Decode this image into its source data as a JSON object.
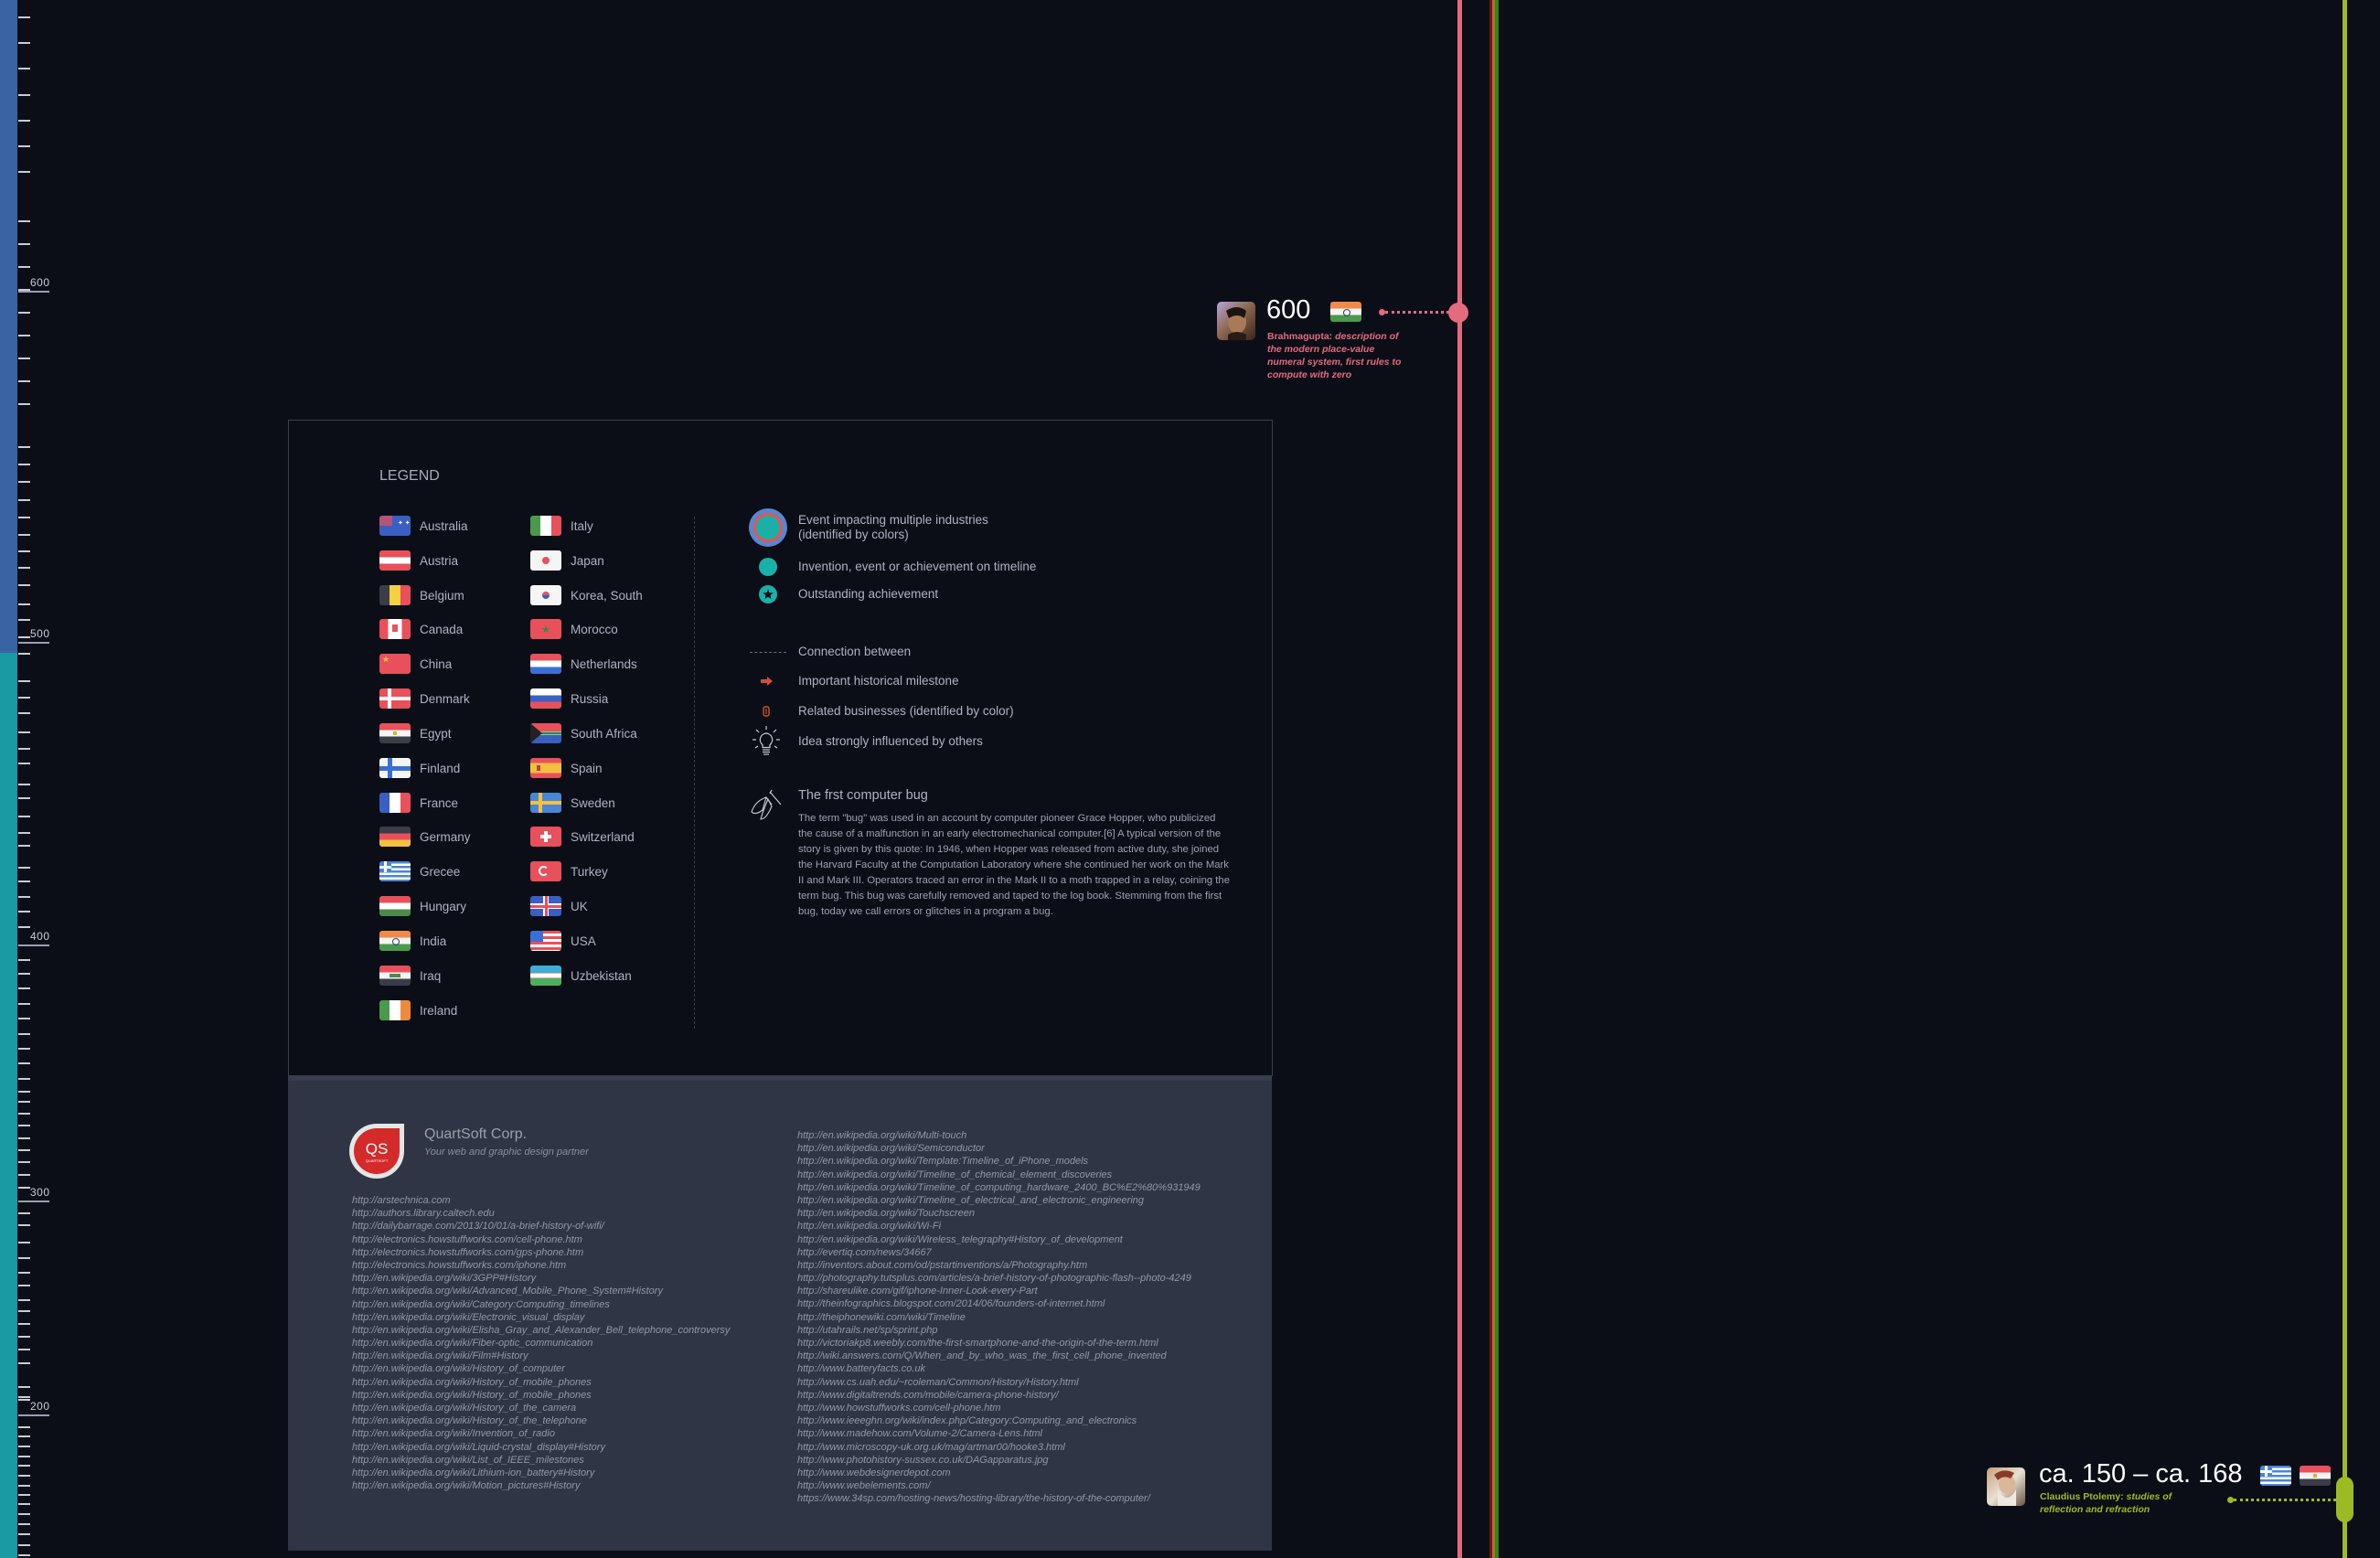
{
  "ruler": {
    "labels": [
      {
        "value": "600"
      },
      {
        "value": "500"
      },
      {
        "value": "400"
      },
      {
        "value": "300"
      },
      {
        "value": "200"
      }
    ]
  },
  "timeline": {
    "colors": {
      "pink": "#e46a80",
      "lime": "#9bbb25",
      "orange": "#c4682a",
      "green": "#2a8a1c"
    },
    "events": [
      {
        "year": "600",
        "person": "Brahmagupta:",
        "description": "description of the modern place-value numeral system, first rules to compute with zero",
        "flags": [
          "India"
        ],
        "color": "#e46a80"
      },
      {
        "year": "ca. 150 – ca. 168",
        "person": "Claudius Ptolemy:",
        "description": "studies of reflection and refraction",
        "flags": [
          "Greece",
          "Egypt"
        ],
        "color": "#9bbb25"
      }
    ]
  },
  "legend": {
    "title": "LEGEND",
    "countries_left": [
      "Australia",
      "Austria",
      "Belgium",
      "Canada",
      "China",
      "Denmark",
      "Egypt",
      "Finland",
      "France",
      "Germany",
      "Grecee",
      "Hungary",
      "India",
      "Iraq",
      "Ireland"
    ],
    "countries_right": [
      "Italy",
      "Japan",
      "Korea, South",
      "Morocco",
      "Netherlands",
      "Russia",
      "South Africa",
      "Spain",
      "Sweden",
      "Switzerland",
      "Turkey",
      "UK",
      "USA",
      "Uzbekistan"
    ],
    "symbols": [
      {
        "icon": "multi-industry-event-icon",
        "label": "Event impacting multiple industries",
        "label2": "(identified by colors)"
      },
      {
        "icon": "event-dot-icon",
        "label": "Invention, event or achievement on timeline"
      },
      {
        "icon": "star-achievement-icon",
        "label": "Outstanding achievement"
      },
      {
        "icon": "dashed-connection-icon",
        "label": "Connection between"
      },
      {
        "icon": "arrow-milestone-icon",
        "label": "Important historical milestone"
      },
      {
        "icon": "business-link-icon",
        "label": "Related businesses (identified by color)"
      },
      {
        "icon": "lightbulb-icon",
        "label": "Idea strongly influenced by others"
      }
    ],
    "bug": {
      "title": "The frst computer bug",
      "text": "The term \"bug\" was used in an account by computer pioneer Grace Hopper, who publicized the cause of a malfunction in an early electromechanical computer.[6] A typical version of the story is given by this quote:  In 1946, when Hopper was released from active duty, she joined the Harvard Faculty at the Computation Laboratory where she continued her work on the Mark II and Mark III. Operators traced an error in the Mark II to a moth trapped in a relay, coining the term bug. This bug was carefully removed and taped to the log book. Stemming from the first bug, today we call errors or glitches in a program a bug."
    }
  },
  "footer": {
    "logo_text": "QS",
    "logo_subtext": "QUARTSOFT",
    "company": "QuartSoft Corp.",
    "tagline": "Your web and graphic design partner",
    "links_left": [
      "http://arstechnica.com",
      "http://authors.library.caltech.edu",
      "http://dailybarrage.com/2013/10/01/a-brief-history-of-wifi/",
      "http://electronics.howstuffworks.com/cell-phone.htm",
      "http://electronics.howstuffworks.com/gps-phone.htm",
      "http://electronics.howstuffworks.com/iphone.htm",
      "http://en.wikipedia.org/wiki/3GPP#History",
      "http://en.wikipedia.org/wiki/Advanced_Mobile_Phone_System#History",
      "http://en.wikipedia.org/wiki/Category:Computing_timelines",
      "http://en.wikipedia.org/wiki/Electronic_visual_display",
      "http://en.wikipedia.org/wiki/Elisha_Gray_and_Alexander_Bell_telephone_controversy",
      "http://en.wikipedia.org/wiki/Fiber-optic_communication",
      "http://en.wikipedia.org/wiki/Film#History",
      "http://en.wikipedia.org/wiki/History_of_computer",
      "http://en.wikipedia.org/wiki/History_of_mobile_phones",
      "http://en.wikipedia.org/wiki/History_of_mobile_phones",
      "http://en.wikipedia.org/wiki/History_of_the_camera",
      "http://en.wikipedia.org/wiki/History_of_the_telephone",
      "http://en.wikipedia.org/wiki/Invention_of_radio",
      "http://en.wikipedia.org/wiki/Liquid-crystal_display#History",
      "http://en.wikipedia.org/wiki/List_of_IEEE_milestones",
      "http://en.wikipedia.org/wiki/Lithium-ion_battery#History",
      "http://en.wikipedia.org/wiki/Motion_pictures#History"
    ],
    "links_right": [
      "http://en.wikipedia.org/wiki/Multi-touch",
      "http://en.wikipedia.org/wiki/Semiconductor",
      "http://en.wikipedia.org/wiki/Template:Timeline_of_iPhone_models",
      "http://en.wikipedia.org/wiki/Timeline_of_chemical_element_discoveries",
      "http://en.wikipedia.org/wiki/Timeline_of_computing_hardware_2400_BC%E2%80%931949",
      "http://en.wikipedia.org/wiki/Timeline_of_electrical_and_electronic_engineering",
      "http://en.wikipedia.org/wiki/Touchscreen",
      "http://en.wikipedia.org/wiki/Wi-Fi",
      "http://en.wikipedia.org/wiki/Wireless_telegraphy#History_of_development",
      "http://evertiq.com/news/34667",
      "http://inventors.about.com/od/pstartinventions/a/Photography.htm",
      "http://photography.tutsplus.com/articles/a-brief-history-of-photographic-flash--photo-4249",
      "http://shareulike.com/gif/iphone-Inner-Look-every-Part",
      "http://theinfographics.blogspot.com/2014/06/founders-of-internet.html",
      "http://theiphonewiki.com/wiki/Timeline",
      "http://utahrails.net/sp/sprint.php",
      "http://victoriakp8.weebly.com/the-first-smartphone-and-the-origin-of-the-term.html",
      "http://wiki.answers.com/Q/When_and_by_who_was_the_first_cell_phone_invented",
      "http://www.batteryfacts.co.uk",
      "http://www.cs.uah.edu/~rcoleman/Common/History/History.html",
      "http://www.digitaltrends.com/mobile/camera-phone-history/",
      "http://www.howstuffworks.com/cell-phone.htm",
      "http://www.ieeeghn.org/wiki/index.php/Category:Computing_and_electronics",
      "http://www.madehow.com/Volume-2/Camera-Lens.html",
      "http://www.microscopy-uk.org.uk/mag/artmar00/hooke3.html",
      "http://www.photohistory-sussex.co.uk/DAGapparatus.jpg",
      "http://www.webdesignerdepot.com",
      "http://www.webelements.com/",
      "https://www.34sp.com/hosting-news/hosting-library/the-history-of-the-computer/"
    ]
  }
}
